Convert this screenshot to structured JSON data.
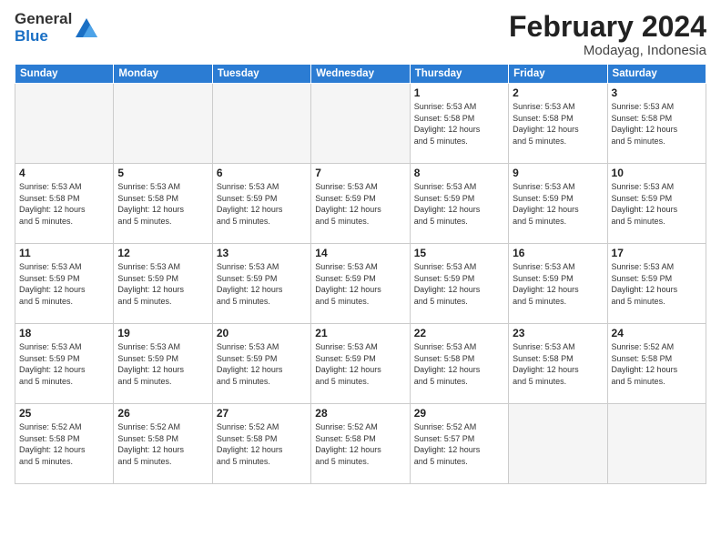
{
  "header": {
    "logo": {
      "general": "General",
      "blue": "Blue"
    },
    "title": "February 2024",
    "location": "Modayag, Indonesia"
  },
  "days_of_week": [
    "Sunday",
    "Monday",
    "Tuesday",
    "Wednesday",
    "Thursday",
    "Friday",
    "Saturday"
  ],
  "weeks": [
    [
      {
        "day": "",
        "info": ""
      },
      {
        "day": "",
        "info": ""
      },
      {
        "day": "",
        "info": ""
      },
      {
        "day": "",
        "info": ""
      },
      {
        "day": "1",
        "info": "Sunrise: 5:53 AM\nSunset: 5:58 PM\nDaylight: 12 hours\nand 5 minutes."
      },
      {
        "day": "2",
        "info": "Sunrise: 5:53 AM\nSunset: 5:58 PM\nDaylight: 12 hours\nand 5 minutes."
      },
      {
        "day": "3",
        "info": "Sunrise: 5:53 AM\nSunset: 5:58 PM\nDaylight: 12 hours\nand 5 minutes."
      }
    ],
    [
      {
        "day": "4",
        "info": "Sunrise: 5:53 AM\nSunset: 5:58 PM\nDaylight: 12 hours\nand 5 minutes."
      },
      {
        "day": "5",
        "info": "Sunrise: 5:53 AM\nSunset: 5:58 PM\nDaylight: 12 hours\nand 5 minutes."
      },
      {
        "day": "6",
        "info": "Sunrise: 5:53 AM\nSunset: 5:59 PM\nDaylight: 12 hours\nand 5 minutes."
      },
      {
        "day": "7",
        "info": "Sunrise: 5:53 AM\nSunset: 5:59 PM\nDaylight: 12 hours\nand 5 minutes."
      },
      {
        "day": "8",
        "info": "Sunrise: 5:53 AM\nSunset: 5:59 PM\nDaylight: 12 hours\nand 5 minutes."
      },
      {
        "day": "9",
        "info": "Sunrise: 5:53 AM\nSunset: 5:59 PM\nDaylight: 12 hours\nand 5 minutes."
      },
      {
        "day": "10",
        "info": "Sunrise: 5:53 AM\nSunset: 5:59 PM\nDaylight: 12 hours\nand 5 minutes."
      }
    ],
    [
      {
        "day": "11",
        "info": "Sunrise: 5:53 AM\nSunset: 5:59 PM\nDaylight: 12 hours\nand 5 minutes."
      },
      {
        "day": "12",
        "info": "Sunrise: 5:53 AM\nSunset: 5:59 PM\nDaylight: 12 hours\nand 5 minutes."
      },
      {
        "day": "13",
        "info": "Sunrise: 5:53 AM\nSunset: 5:59 PM\nDaylight: 12 hours\nand 5 minutes."
      },
      {
        "day": "14",
        "info": "Sunrise: 5:53 AM\nSunset: 5:59 PM\nDaylight: 12 hours\nand 5 minutes."
      },
      {
        "day": "15",
        "info": "Sunrise: 5:53 AM\nSunset: 5:59 PM\nDaylight: 12 hours\nand 5 minutes."
      },
      {
        "day": "16",
        "info": "Sunrise: 5:53 AM\nSunset: 5:59 PM\nDaylight: 12 hours\nand 5 minutes."
      },
      {
        "day": "17",
        "info": "Sunrise: 5:53 AM\nSunset: 5:59 PM\nDaylight: 12 hours\nand 5 minutes."
      }
    ],
    [
      {
        "day": "18",
        "info": "Sunrise: 5:53 AM\nSunset: 5:59 PM\nDaylight: 12 hours\nand 5 minutes."
      },
      {
        "day": "19",
        "info": "Sunrise: 5:53 AM\nSunset: 5:59 PM\nDaylight: 12 hours\nand 5 minutes."
      },
      {
        "day": "20",
        "info": "Sunrise: 5:53 AM\nSunset: 5:59 PM\nDaylight: 12 hours\nand 5 minutes."
      },
      {
        "day": "21",
        "info": "Sunrise: 5:53 AM\nSunset: 5:59 PM\nDaylight: 12 hours\nand 5 minutes."
      },
      {
        "day": "22",
        "info": "Sunrise: 5:53 AM\nSunset: 5:58 PM\nDaylight: 12 hours\nand 5 minutes."
      },
      {
        "day": "23",
        "info": "Sunrise: 5:53 AM\nSunset: 5:58 PM\nDaylight: 12 hours\nand 5 minutes."
      },
      {
        "day": "24",
        "info": "Sunrise: 5:52 AM\nSunset: 5:58 PM\nDaylight: 12 hours\nand 5 minutes."
      }
    ],
    [
      {
        "day": "25",
        "info": "Sunrise: 5:52 AM\nSunset: 5:58 PM\nDaylight: 12 hours\nand 5 minutes."
      },
      {
        "day": "26",
        "info": "Sunrise: 5:52 AM\nSunset: 5:58 PM\nDaylight: 12 hours\nand 5 minutes."
      },
      {
        "day": "27",
        "info": "Sunrise: 5:52 AM\nSunset: 5:58 PM\nDaylight: 12 hours\nand 5 minutes."
      },
      {
        "day": "28",
        "info": "Sunrise: 5:52 AM\nSunset: 5:58 PM\nDaylight: 12 hours\nand 5 minutes."
      },
      {
        "day": "29",
        "info": "Sunrise: 5:52 AM\nSunset: 5:57 PM\nDaylight: 12 hours\nand 5 minutes."
      },
      {
        "day": "",
        "info": ""
      },
      {
        "day": "",
        "info": ""
      }
    ]
  ]
}
